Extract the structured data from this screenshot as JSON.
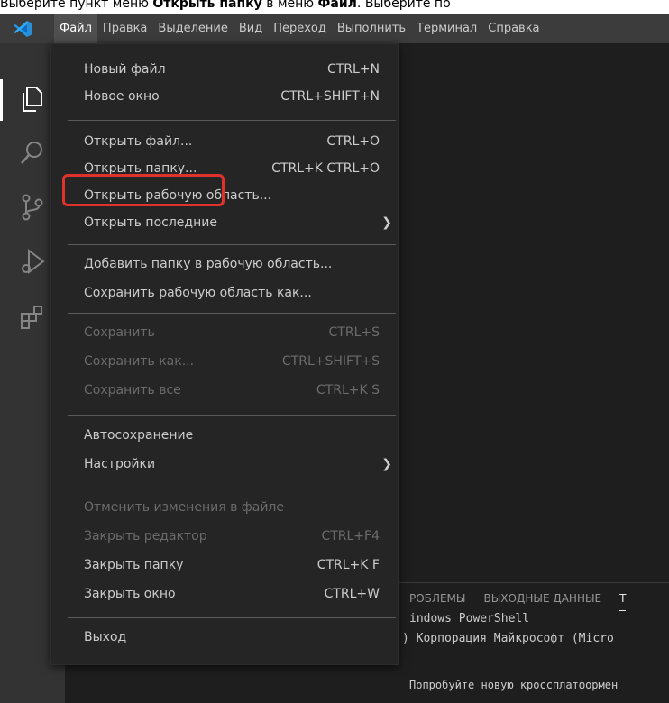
{
  "caption": {
    "prefix": "Выберите пункт меню ",
    "bold1": "Открыть папку",
    "middle": " в меню ",
    "bold2": "Файл",
    "suffix": ". Выберите по"
  },
  "menubar": [
    "Файл",
    "Правка",
    "Выделение",
    "Вид",
    "Переход",
    "Выполнить",
    "Терминал",
    "Справка"
  ],
  "file_menu": {
    "new_file": {
      "label": "Новый файл",
      "shortcut": "CTRL+N"
    },
    "new_window": {
      "label": "Новое окно",
      "shortcut": "CTRL+SHIFT+N"
    },
    "open_file": {
      "label": "Открыть файл...",
      "shortcut": "CTRL+O"
    },
    "open_folder": {
      "label": "Открыть папку...",
      "shortcut": "CTRL+K CTRL+O"
    },
    "open_workspace": {
      "label": "Открыть рабочую область..."
    },
    "open_recent": {
      "label": "Открыть последние"
    },
    "add_folder": {
      "label": "Добавить папку в рабочую область..."
    },
    "save_workspace_as": {
      "label": "Сохранить рабочую область как..."
    },
    "save": {
      "label": "Сохранить",
      "shortcut": "CTRL+S"
    },
    "save_as": {
      "label": "Сохранить как...",
      "shortcut": "CTRL+SHIFT+S"
    },
    "save_all": {
      "label": "Сохранить все",
      "shortcut": "CTRL+K S"
    },
    "autosave": {
      "label": "Автосохранение"
    },
    "settings": {
      "label": "Настройки"
    },
    "revert": {
      "label": "Отменить изменения в файле"
    },
    "close_editor": {
      "label": "Закрыть редактор",
      "shortcut": "CTRL+F4"
    },
    "close_folder": {
      "label": "Закрыть папку",
      "shortcut": "CTRL+K F"
    },
    "close_window": {
      "label": "Закрыть окно",
      "shortcut": "CTRL+W"
    },
    "exit": {
      "label": "Выход"
    }
  },
  "panel": {
    "tabs": [
      "РОБЛЕМЫ",
      "ВЫХОДНЫЕ ДАННЫЕ",
      "Т"
    ],
    "lines": [
      "indows PowerShell",
      ") Корпорация Майкрософт (Micro",
      "Попробуйте новую кроссплатформен"
    ]
  },
  "colors": {
    "accent_highlight": "#e0312a",
    "menu_bg": "#252526",
    "activity_bar": "#333333"
  }
}
